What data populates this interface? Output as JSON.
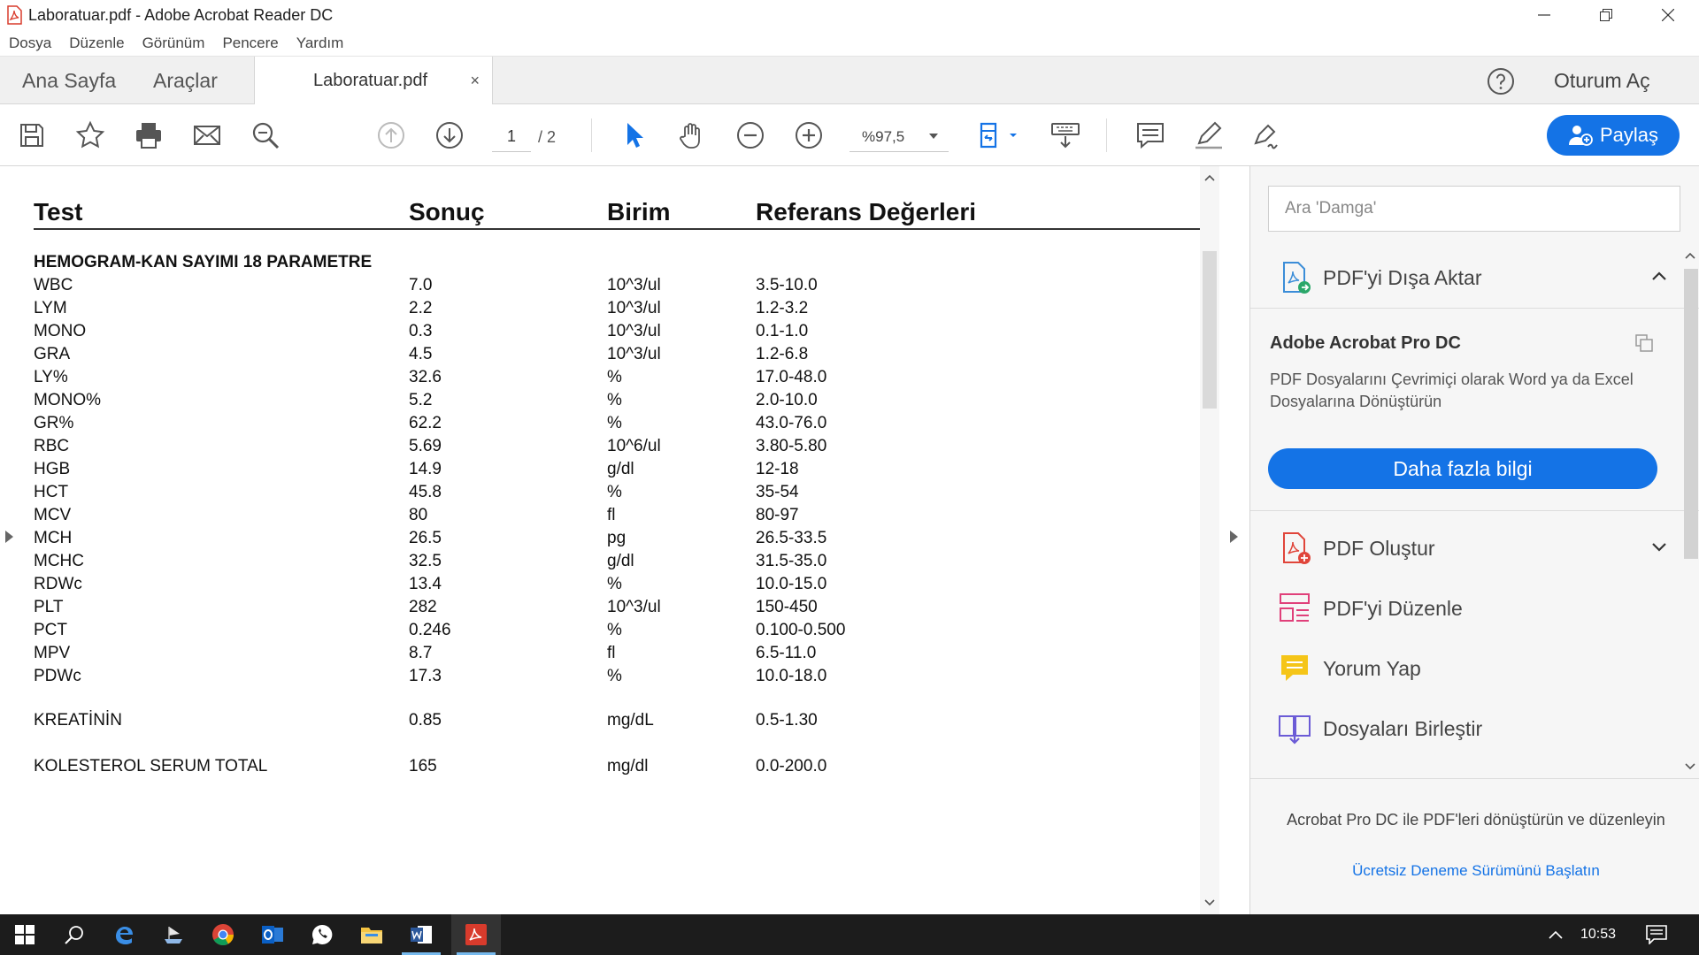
{
  "window": {
    "title": "Laboratuar.pdf - Adobe Acrobat Reader DC"
  },
  "menu": [
    "Dosya",
    "Düzenle",
    "Görünüm",
    "Pencere",
    "Yardım"
  ],
  "tabs": {
    "home": "Ana Sayfa",
    "tools": "Araçlar",
    "document": "Laboratuar.pdf",
    "close": "×",
    "sign_in": "Oturum Aç"
  },
  "toolbar": {
    "page_current": "1",
    "page_total": "/ 2",
    "zoom": "%97,5",
    "share_label": "Paylaş"
  },
  "document": {
    "headers": [
      "Test",
      "Sonuç",
      "Birim",
      "Referans Değerleri"
    ],
    "section_title": "HEMOGRAM-KAN SAYIMI 18 PARAMETRE",
    "rows": [
      [
        "WBC",
        "7.0",
        "10^3/ul",
        "3.5-10.0"
      ],
      [
        "LYM",
        "2.2",
        "10^3/ul",
        "1.2-3.2"
      ],
      [
        "MONO",
        "0.3",
        "10^3/ul",
        "0.1-1.0"
      ],
      [
        "GRA",
        "4.5",
        "10^3/ul",
        "1.2-6.8"
      ],
      [
        "LY%",
        "32.6",
        "%",
        "17.0-48.0"
      ],
      [
        "MONO%",
        "5.2",
        "%",
        "2.0-10.0"
      ],
      [
        "GR%",
        "62.2",
        "%",
        "43.0-76.0"
      ],
      [
        "RBC",
        "5.69",
        "10^6/ul",
        "3.80-5.80"
      ],
      [
        "HGB",
        "14.9",
        "g/dl",
        "12-18"
      ],
      [
        "HCT",
        "45.8",
        "%",
        "35-54"
      ],
      [
        "MCV",
        "80",
        "fl",
        "80-97"
      ],
      [
        "MCH",
        "26.5",
        "pg",
        "26.5-33.5"
      ],
      [
        "MCHC",
        "32.5",
        "g/dl",
        "31.5-35.0"
      ],
      [
        "RDWc",
        "13.4",
        "%",
        "10.0-15.0"
      ],
      [
        "PLT",
        "282",
        "10^3/ul",
        "150-450"
      ],
      [
        "PCT",
        "0.246",
        "%",
        "0.100-0.500"
      ],
      [
        "MPV",
        "8.7",
        "fl",
        "6.5-11.0"
      ],
      [
        "PDWc",
        "17.3",
        "%",
        "10.0-18.0"
      ]
    ],
    "extra_rows": [
      [
        "KREATİNİN",
        "0.85",
        "mg/dL",
        "0.5-1.30"
      ],
      [
        "KOLESTEROL SERUM TOTAL",
        "165",
        "mg/dl",
        "0.0-200.0"
      ]
    ]
  },
  "right_pane": {
    "search_placeholder": "Ara 'Damga'",
    "export_label": "PDF'yi Dışa Aktar",
    "promo_title": "Adobe Acrobat Pro DC",
    "promo_text": "PDF Dosyalarını Çevrimiçi olarak Word ya da Excel Dosyalarına Dönüştürün",
    "promo_button": "Daha fazla bilgi",
    "tools": [
      "PDF Oluştur",
      "PDF'yi Düzenle",
      "Yorum Yap",
      "Dosyaları Birleştir"
    ],
    "footer_text": "Acrobat Pro DC ile PDF'leri dönüştürün ve düzenleyin",
    "footer_link": "Ücretsiz Deneme Sürümünü Başlatın"
  },
  "taskbar": {
    "time": "10:53"
  },
  "colors": {
    "accent": "#1473e6",
    "acrobat_red": "#d83b2c",
    "taskbar": "#1c1c1c"
  }
}
